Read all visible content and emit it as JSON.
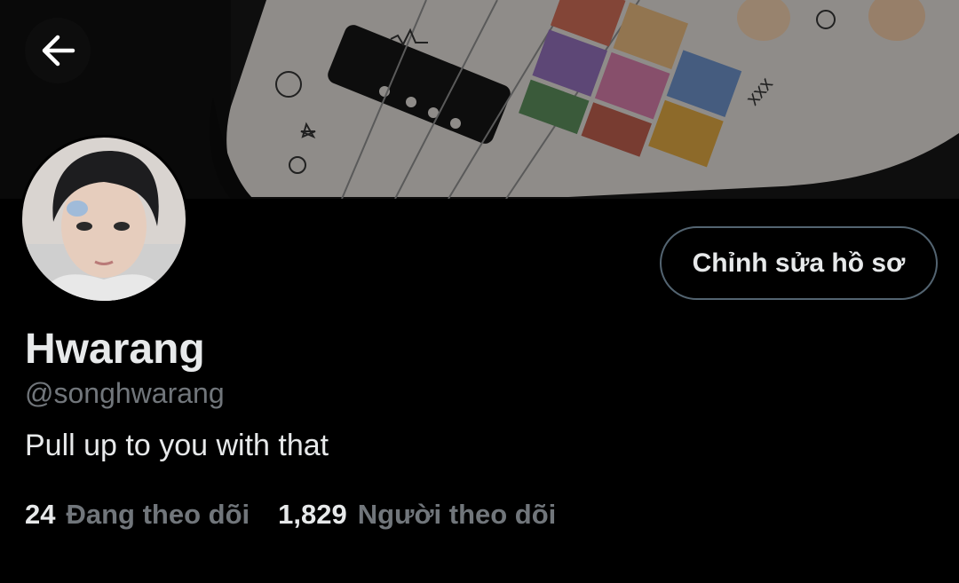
{
  "header": {
    "back_icon": "arrow-left-icon"
  },
  "banner": {
    "description_icon": "banner-image",
    "colors": {
      "bg": "#141414",
      "guitar_body": "#e9e6e3"
    }
  },
  "profile": {
    "display_name": "Hwarang",
    "handle": "@songhwarang",
    "bio": "Pull up to you with that",
    "edit_button_label": "Chỉnh sửa hồ sơ"
  },
  "stats": {
    "following_count": "24",
    "following_label": "Đang theo dõi",
    "followers_count": "1,829",
    "followers_label": "Người theo dõi"
  },
  "colors": {
    "background": "#000000",
    "primary_text": "#e7e9ea",
    "secondary_text": "#71767b",
    "border": "#536471"
  }
}
